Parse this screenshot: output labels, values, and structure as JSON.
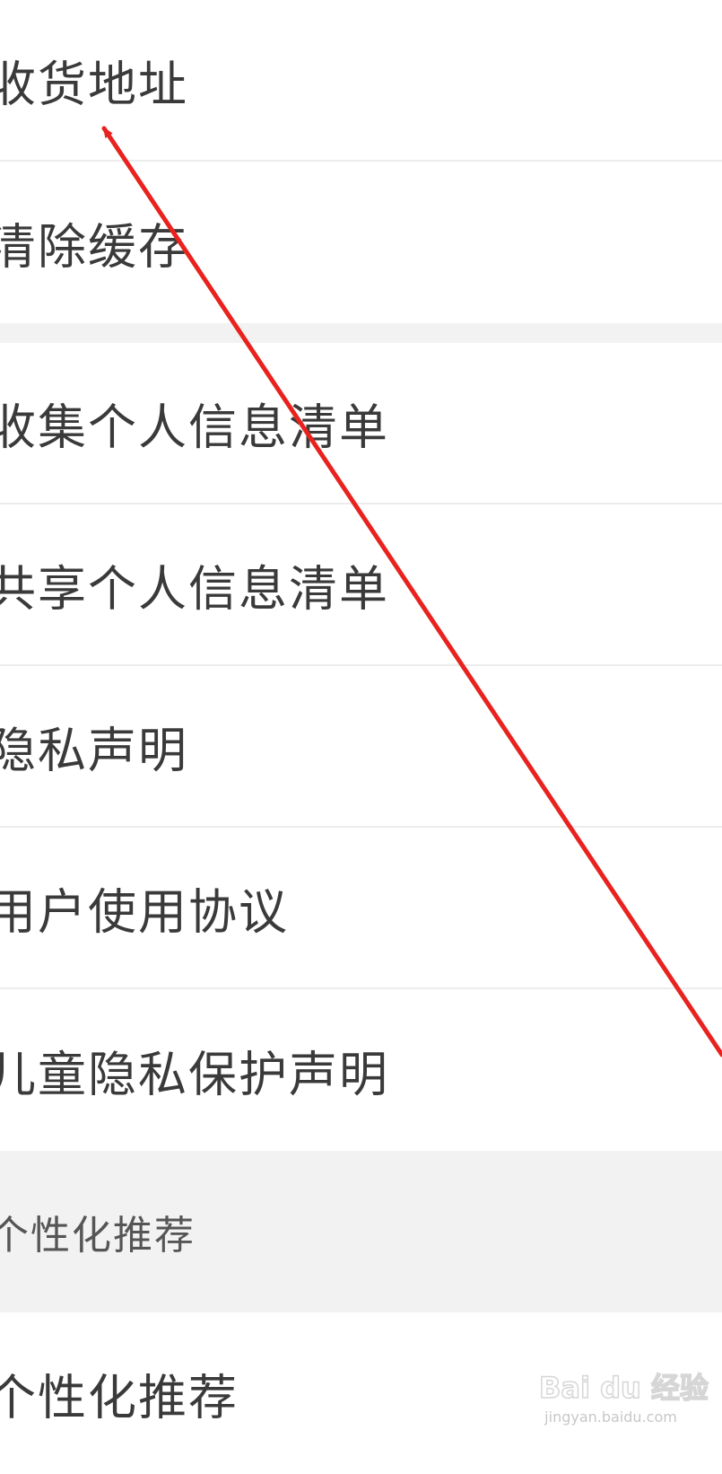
{
  "settings": {
    "group1": [
      {
        "label": "收货地址"
      },
      {
        "label": "清除缓存"
      }
    ],
    "group2": [
      {
        "label": "收集个人信息清单"
      },
      {
        "label": "共享个人信息清单"
      },
      {
        "label": "隐私声明"
      },
      {
        "label": "用户使用协议"
      },
      {
        "label": "儿童隐私保护声明"
      }
    ],
    "personalization_section": {
      "header": "个性化推荐",
      "item_label": "个性化推荐"
    }
  },
  "annotation": {
    "arrow_color": "#e8231f"
  },
  "watermark": {
    "logo": "Bai du 经验",
    "url": "jingyan.baidu.com"
  }
}
